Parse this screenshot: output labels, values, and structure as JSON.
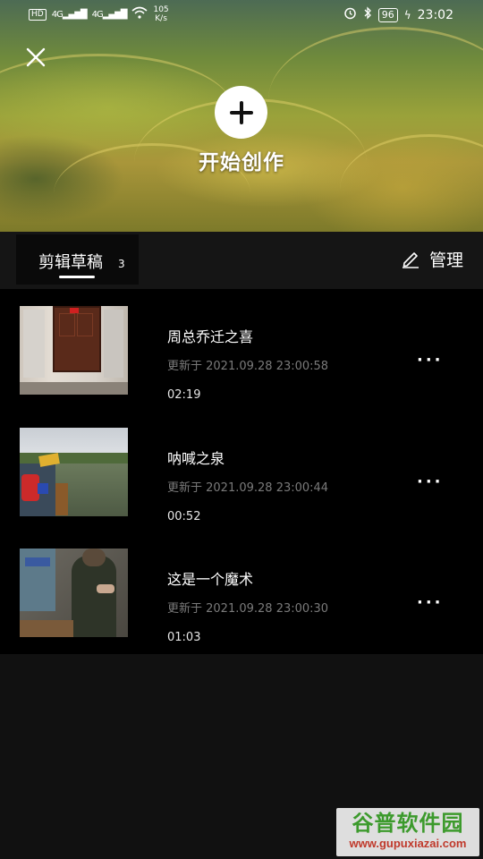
{
  "status_bar": {
    "left_tag": "HD",
    "signal_1": "4G",
    "signal_2": "4G",
    "speed": "105",
    "speed_unit": "K/s",
    "battery": "96",
    "time": "23:02"
  },
  "hero": {
    "create_label": "开始创作"
  },
  "tabs": {
    "drafts_label": "剪辑草稿",
    "drafts_count": "3",
    "manage_label": "管理"
  },
  "drafts": [
    {
      "title": "周总乔迁之喜",
      "updated": "更新于 2021.09.28 23:00:58",
      "duration": "02:19",
      "more": "···"
    },
    {
      "title": "呐喊之泉",
      "updated": "更新于 2021.09.28 23:00:44",
      "duration": "00:52",
      "more": "···"
    },
    {
      "title": "这是一个魔术",
      "updated": "更新于 2021.09.28 23:00:30",
      "duration": "01:03",
      "more": "···"
    }
  ],
  "watermark": {
    "main": "谷普软件园",
    "url": "www.gupuxiazai.com"
  },
  "icons": {
    "close": "close-icon",
    "plus": "plus-icon",
    "edit": "pencil-icon",
    "wifi": "wifi-icon",
    "alarm": "alarm-icon",
    "bluetooth": "bluetooth-icon",
    "charging": "charging-icon"
  }
}
